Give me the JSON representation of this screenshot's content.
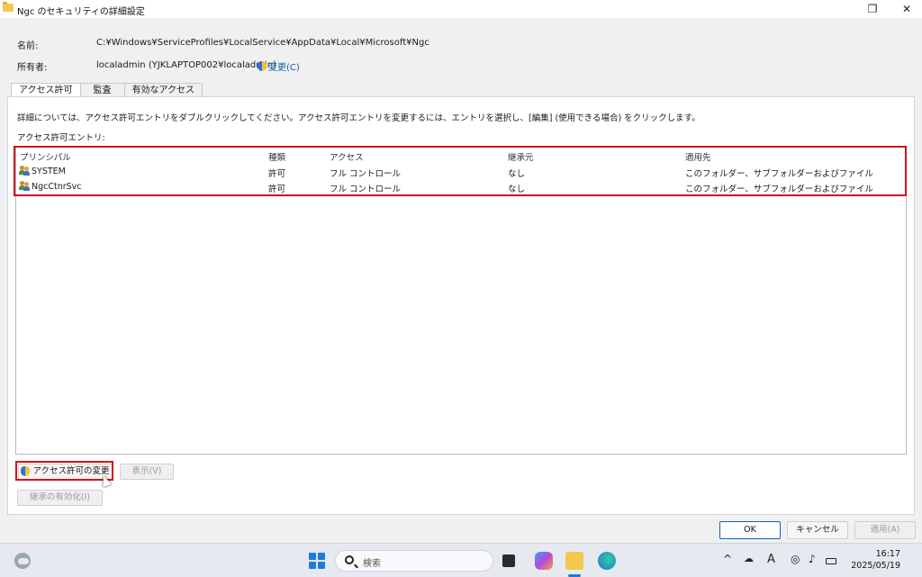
{
  "window": {
    "title": "Ngc のセキュリティの詳細設定",
    "controls": {
      "maximize": "❐",
      "close": "✕"
    }
  },
  "info": {
    "name_label": "名前:",
    "name_value": "C:¥Windows¥ServiceProfiles¥LocalService¥AppData¥Local¥Microsoft¥Ngc",
    "owner_label": "所有者:",
    "owner_value": "localadmin (YJKLAPTOP002¥localadmin)",
    "change_link": "変更(C)"
  },
  "tabs": [
    {
      "label": "アクセス許可",
      "active": true
    },
    {
      "label": "監査",
      "active": false
    },
    {
      "label": "有効なアクセス",
      "active": false
    }
  ],
  "panel": {
    "description": "詳細については、アクセス許可エントリをダブルクリックしてください。アクセス許可エントリを変更するには、エントリを選択し、[編集] (使用できる場合) をクリックします。",
    "list_label": "アクセス許可エントリ:"
  },
  "table": {
    "headers": [
      "プリンシパル",
      "種類",
      "アクセス",
      "継承元",
      "適用先"
    ],
    "rows": [
      {
        "principal": "SYSTEM",
        "type": "許可",
        "access": "フル コントロール",
        "inherited": "なし",
        "applies": "このフォルダー、サブフォルダーおよびファイル"
      },
      {
        "principal": "NgcCtnrSvc",
        "type": "許可",
        "access": "フル コントロール",
        "inherited": "なし",
        "applies": "このフォルダー、サブフォルダーおよびファイル"
      }
    ]
  },
  "buttons": {
    "change_permissions": "アクセス許可の変更",
    "view": "表示(V)",
    "enable_inheritance": "継承の有効化(I)",
    "ok": "OK",
    "cancel": "キャンセル",
    "apply": "適用(A)"
  },
  "taskbar": {
    "search_placeholder": "検索",
    "tray_chevron": "^",
    "tray_font": "A",
    "time": "16:17",
    "date": "2025/05/19"
  },
  "colors": {
    "highlight": "#d0121b",
    "link": "#0b5cad",
    "accent": "#1f7ad9"
  }
}
